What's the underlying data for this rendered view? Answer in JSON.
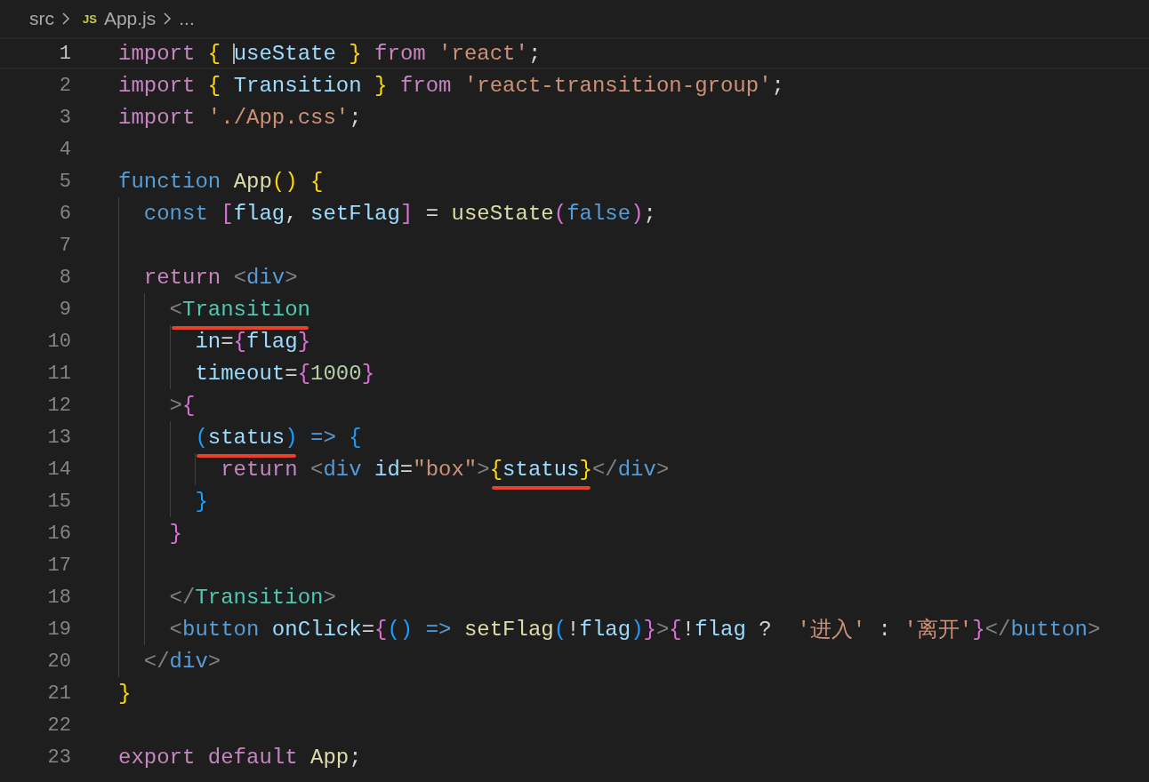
{
  "breadcrumb": {
    "folder": "src",
    "file_icon_text": "JS",
    "file": "App.js",
    "more": "..."
  },
  "lines": [
    {
      "number": "1",
      "selected": true,
      "tokens": [
        {
          "kind": "kw",
          "text": "import "
        },
        {
          "kind": "b1",
          "text": "{ "
        },
        {
          "kind": "var",
          "text": "useState ",
          "caret": true
        },
        {
          "kind": "b1",
          "text": "} "
        },
        {
          "kind": "kw",
          "text": "from "
        },
        {
          "kind": "str",
          "text": "'react'"
        },
        {
          "kind": "plain",
          "text": ";"
        }
      ]
    },
    {
      "number": "2",
      "selected": false,
      "tokens": [
        {
          "kind": "kw",
          "text": "import "
        },
        {
          "kind": "b1",
          "text": "{ "
        },
        {
          "kind": "var",
          "text": "Transition "
        },
        {
          "kind": "b1",
          "text": "} "
        },
        {
          "kind": "kw",
          "text": "from "
        },
        {
          "kind": "str",
          "text": "'react-transition-group'"
        },
        {
          "kind": "plain",
          "text": ";"
        }
      ]
    },
    {
      "number": "3",
      "selected": false,
      "tokens": [
        {
          "kind": "kw",
          "text": "import "
        },
        {
          "kind": "str",
          "text": "'./App.css'"
        },
        {
          "kind": "plain",
          "text": ";"
        }
      ]
    },
    {
      "number": "4",
      "selected": false
    },
    {
      "number": "5",
      "selected": false,
      "tokens": [
        {
          "kind": "storage",
          "text": "function "
        },
        {
          "kind": "fn",
          "text": "App"
        },
        {
          "kind": "b1",
          "text": "() {"
        }
      ],
      "children": [
        {
          "number": "6",
          "selected": false,
          "tokens": [
            {
              "kind": "storage",
              "text": "const "
            },
            {
              "kind": "b2",
              "text": "["
            },
            {
              "kind": "var",
              "text": "flag"
            },
            {
              "kind": "plain",
              "text": ", "
            },
            {
              "kind": "var",
              "text": "setFlag"
            },
            {
              "kind": "b2",
              "text": "]"
            },
            {
              "kind": "plain",
              "text": " = "
            },
            {
              "kind": "fn",
              "text": "useState"
            },
            {
              "kind": "b2",
              "text": "("
            },
            {
              "kind": "storage",
              "text": "false"
            },
            {
              "kind": "b2",
              "text": ")"
            },
            {
              "kind": "plain",
              "text": ";"
            }
          ]
        },
        {
          "number": "7",
          "selected": false
        },
        {
          "number": "8",
          "selected": false,
          "tokens": [
            {
              "kind": "kw",
              "text": "return "
            },
            {
              "kind": "tagp",
              "text": "<"
            },
            {
              "kind": "tag",
              "text": "div"
            },
            {
              "kind": "tagp",
              "text": ">"
            }
          ],
          "children": [
            {
              "number": "9",
              "selected": false,
              "tokens": [
                {
                  "kind": "underline",
                  "tokens": [
                    {
                      "kind": "tagp",
                      "text": "<"
                    },
                    {
                      "kind": "comp",
                      "text": "Transition"
                    }
                  ]
                }
              ],
              "children": [
                {
                  "number": "10",
                  "selected": false,
                  "tokens": [
                    {
                      "kind": "attr",
                      "text": "in"
                    },
                    {
                      "kind": "plain",
                      "text": "="
                    },
                    {
                      "kind": "b2",
                      "text": "{"
                    },
                    {
                      "kind": "var",
                      "text": "flag"
                    },
                    {
                      "kind": "b2",
                      "text": "}"
                    }
                  ]
                },
                {
                  "number": "11",
                  "selected": false,
                  "tokens": [
                    {
                      "kind": "attr",
                      "text": "timeout"
                    },
                    {
                      "kind": "plain",
                      "text": "="
                    },
                    {
                      "kind": "b2",
                      "text": "{"
                    },
                    {
                      "kind": "num",
                      "text": "1000"
                    },
                    {
                      "kind": "b2",
                      "text": "}"
                    }
                  ]
                }
              ]
            },
            {
              "number": "12",
              "selected": false,
              "tokens": [
                {
                  "kind": "tagp",
                  "text": ">"
                },
                {
                  "kind": "b2",
                  "text": "{"
                }
              ],
              "children": [
                {
                  "number": "13",
                  "selected": false,
                  "tokens": [
                    {
                      "kind": "underline",
                      "tokens": [
                        {
                          "kind": "b3",
                          "text": "("
                        },
                        {
                          "kind": "var",
                          "text": "status"
                        },
                        {
                          "kind": "b3",
                          "text": ")"
                        }
                      ]
                    },
                    {
                      "kind": "storage",
                      "text": " => "
                    },
                    {
                      "kind": "b3",
                      "text": "{"
                    }
                  ],
                  "children": [
                    {
                      "number": "14",
                      "selected": false,
                      "tokens": [
                        {
                          "kind": "kw",
                          "text": "return "
                        },
                        {
                          "kind": "tagp",
                          "text": "<"
                        },
                        {
                          "kind": "tag",
                          "text": "div "
                        },
                        {
                          "kind": "attr",
                          "text": "id"
                        },
                        {
                          "kind": "plain",
                          "text": "="
                        },
                        {
                          "kind": "str",
                          "text": "\"box\""
                        },
                        {
                          "kind": "tagp",
                          "text": ">"
                        },
                        {
                          "kind": "underline",
                          "tokens": [
                            {
                              "kind": "b1",
                              "text": "{"
                            },
                            {
                              "kind": "var",
                              "text": "status"
                            },
                            {
                              "kind": "b1",
                              "text": "}"
                            }
                          ]
                        },
                        {
                          "kind": "tagp",
                          "text": "</"
                        },
                        {
                          "kind": "tag",
                          "text": "div"
                        },
                        {
                          "kind": "tagp",
                          "text": ">"
                        }
                      ]
                    }
                  ]
                },
                {
                  "number": "15",
                  "selected": false,
                  "tokens": [
                    {
                      "kind": "b3",
                      "text": "}"
                    }
                  ]
                }
              ]
            },
            {
              "number": "16",
              "selected": false,
              "tokens": [
                {
                  "kind": "b2",
                  "text": "}"
                }
              ]
            },
            {
              "number": "17",
              "selected": false
            },
            {
              "number": "18",
              "selected": false,
              "tokens": [
                {
                  "kind": "tagp",
                  "text": "</"
                },
                {
                  "kind": "comp",
                  "text": "Transition"
                },
                {
                  "kind": "tagp",
                  "text": ">"
                }
              ]
            },
            {
              "number": "19",
              "selected": false,
              "tokens": [
                {
                  "kind": "tagp",
                  "text": "<"
                },
                {
                  "kind": "tag",
                  "text": "button "
                },
                {
                  "kind": "attr",
                  "text": "onClick"
                },
                {
                  "kind": "plain",
                  "text": "="
                },
                {
                  "kind": "b2",
                  "text": "{"
                },
                {
                  "kind": "b3",
                  "text": "()"
                },
                {
                  "kind": "storage",
                  "text": " => "
                },
                {
                  "kind": "fn",
                  "text": "setFlag"
                },
                {
                  "kind": "b3",
                  "text": "("
                },
                {
                  "kind": "plain",
                  "text": "!"
                },
                {
                  "kind": "var",
                  "text": "flag"
                },
                {
                  "kind": "b3",
                  "text": ")"
                },
                {
                  "kind": "b2",
                  "text": "}"
                },
                {
                  "kind": "tagp",
                  "text": ">"
                },
                {
                  "kind": "b2",
                  "text": "{"
                },
                {
                  "kind": "plain",
                  "text": "!"
                },
                {
                  "kind": "var",
                  "text": "flag"
                },
                {
                  "kind": "plain",
                  "text": " ?  "
                },
                {
                  "kind": "str",
                  "text": "'进入'"
                },
                {
                  "kind": "plain",
                  "text": " : "
                },
                {
                  "kind": "str",
                  "text": "'离开'"
                },
                {
                  "kind": "b2",
                  "text": "}"
                },
                {
                  "kind": "tagp",
                  "text": "</"
                },
                {
                  "kind": "tag",
                  "text": "button"
                },
                {
                  "kind": "tagp",
                  "text": ">"
                }
              ]
            }
          ]
        },
        {
          "number": "20",
          "selected": false,
          "tokens": [
            {
              "kind": "tagp",
              "text": "</"
            },
            {
              "kind": "tag",
              "text": "div"
            },
            {
              "kind": "tagp",
              "text": ">"
            }
          ]
        }
      ]
    },
    {
      "number": "21",
      "selected": false,
      "tokens": [
        {
          "kind": "b1",
          "text": "}"
        }
      ]
    },
    {
      "number": "22",
      "selected": false
    },
    {
      "number": "23",
      "selected": false,
      "tokens": [
        {
          "kind": "kw",
          "text": "export default "
        },
        {
          "kind": "fn",
          "text": "App"
        },
        {
          "kind": "plain",
          "text": ";"
        }
      ]
    }
  ]
}
